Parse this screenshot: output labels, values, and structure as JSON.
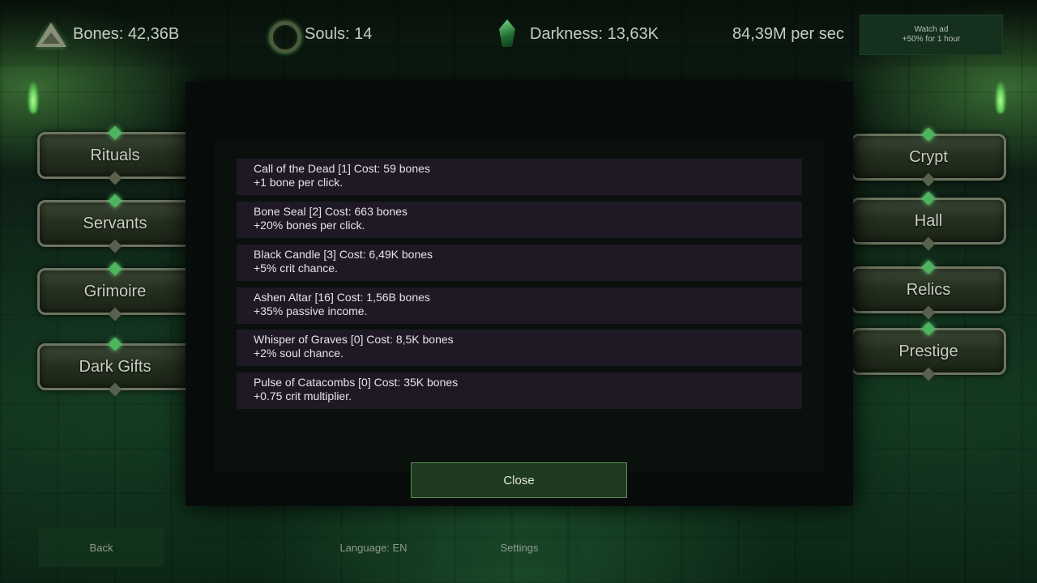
{
  "hud": {
    "bones": "Bones: 42,36B",
    "souls": "Souls: 14",
    "darkness": "Darkness: 13,63K",
    "rate": "84,39M per sec",
    "watch_ad_line1": "Watch ad",
    "watch_ad_line2": "+50% for 1 hour"
  },
  "left_menu": [
    "Rituals",
    "Servants",
    "Grimoire",
    "Dark Gifts"
  ],
  "right_menu": [
    "Crypt",
    "Hall",
    "Relics",
    "Prestige"
  ],
  "modal": {
    "upgrades": [
      {
        "title": "Call of the Dead [1]  Cost: 59 bones",
        "desc": "+1 bone per click."
      },
      {
        "title": "Bone Seal [2]  Cost: 663 bones",
        "desc": "+20% bones per click."
      },
      {
        "title": "Black Candle [3]  Cost: 6,49K bones",
        "desc": "+5% crit chance."
      },
      {
        "title": "Ashen Altar [16]  Cost: 1,56B bones",
        "desc": "+35% passive income."
      },
      {
        "title": "Whisper of Graves [0]  Cost: 8,5K bones",
        "desc": "+2% soul chance."
      },
      {
        "title": "Pulse of Catacombs [0]  Cost: 35K bones",
        "desc": "+0.75 crit multiplier."
      }
    ],
    "close_label": "Close"
  },
  "bottom": {
    "back": "Back",
    "language": "Language: EN",
    "settings": "Settings"
  },
  "icons": {
    "bones": "bone-pyramid-icon",
    "souls": "soul-wreath-icon",
    "darkness": "dark-crystal-icon"
  },
  "colors": {
    "accent_green": "#4fb460",
    "panel_row": "#1f1926",
    "close_button": "#1f3a1e"
  }
}
